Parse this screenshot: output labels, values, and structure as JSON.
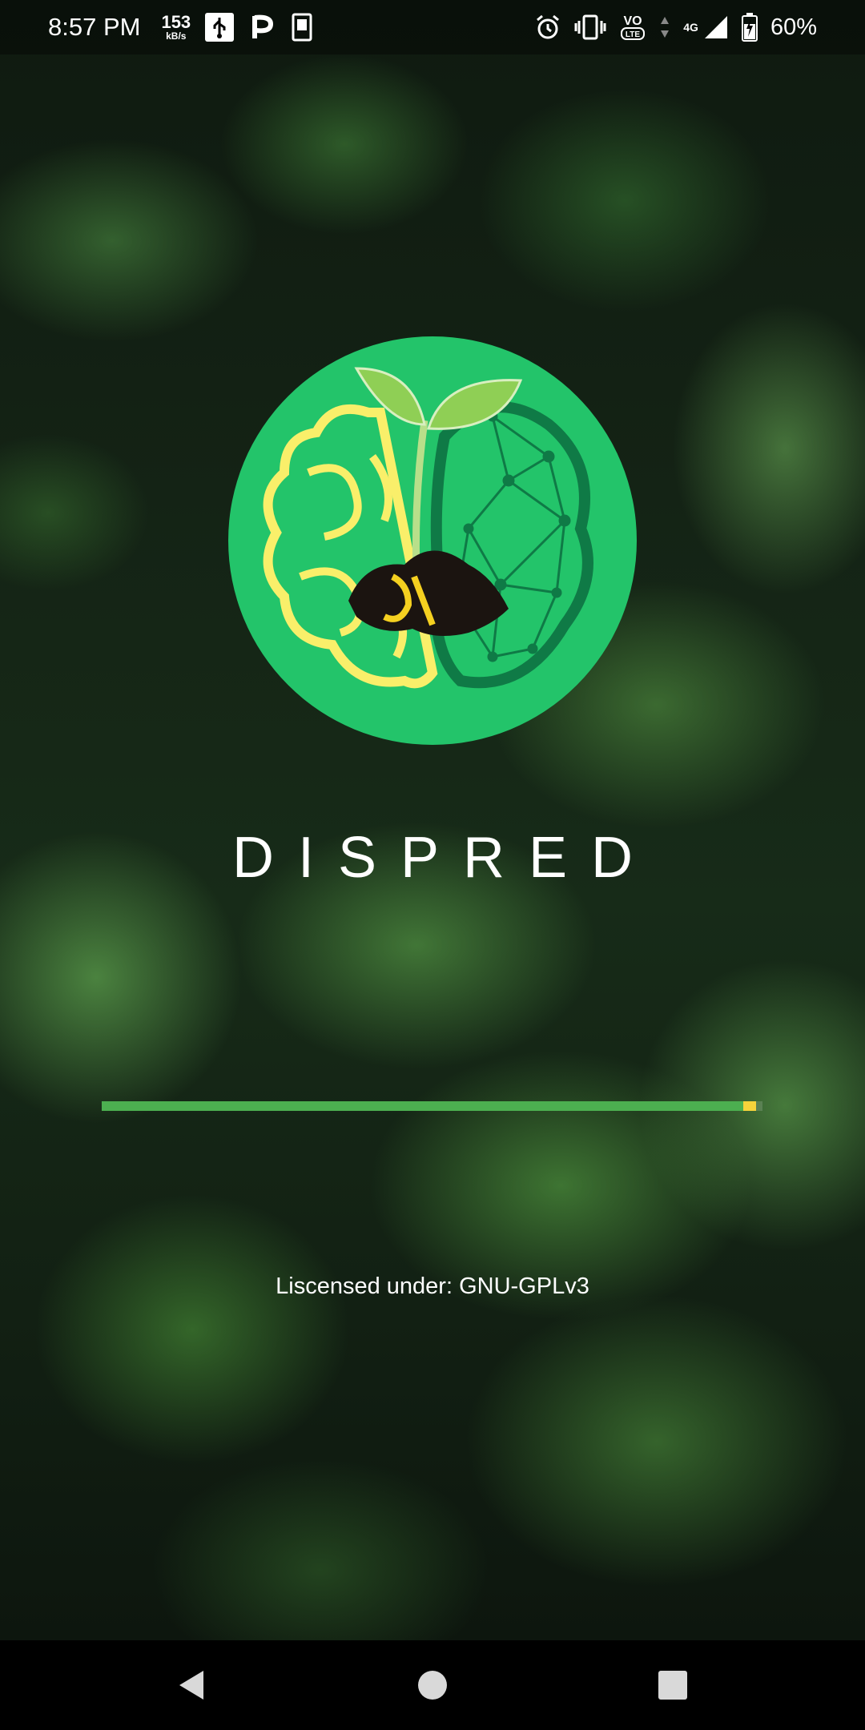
{
  "status_bar": {
    "time": "8:57 PM",
    "net_speed_value": "153",
    "net_speed_unit": "kB/s",
    "left_icons": [
      "usb-icon",
      "paytm-icon",
      "kindle-icon"
    ],
    "right_icons": [
      "alarm-icon",
      "vibrate-icon",
      "volte-icon",
      "data-arrows-icon",
      "signal-icon",
      "battery-icon"
    ],
    "network_type": "4G",
    "volte_label_top": "VO",
    "volte_label_bottom": "LTE",
    "battery_percent": "60%"
  },
  "splash": {
    "logo_icon": "dispred-brain-seedling-logo",
    "title": "DISPRED",
    "license_text": "Liscensed under: GNU-GPLv3"
  },
  "progress": {
    "fraction": 0.99,
    "track_color": "#4caf50",
    "tip_color": "#f5d33b"
  },
  "colors": {
    "logo_circle": "#23c46a",
    "logo_yellow": "#f9ef6a",
    "logo_dark_green": "#0f7a46"
  },
  "nav_bar": {
    "buttons": [
      "back-icon",
      "home-icon",
      "recents-icon"
    ]
  }
}
